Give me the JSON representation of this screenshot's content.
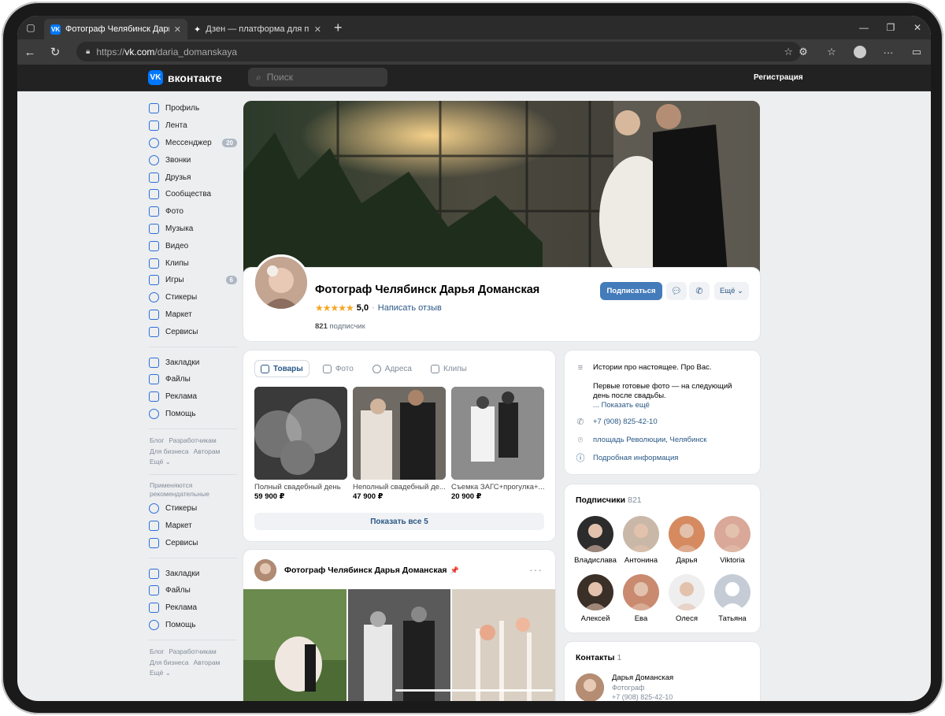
{
  "browser": {
    "tabs": [
      {
        "title": "Фотограф Челябинск Дарья Дом",
        "active": true
      },
      {
        "title": "Дзен — платформа для просмот",
        "active": false
      }
    ],
    "url_prefix": "https://",
    "url_host": "vk.com",
    "url_path": "/daria_domanskaya"
  },
  "vk": {
    "logo_text": "вконтакте",
    "search_placeholder": "Поиск",
    "register": "Регистрация"
  },
  "sidebar": {
    "items": [
      {
        "label": "Профиль",
        "icon": "user-icon"
      },
      {
        "label": "Лента",
        "icon": "news-icon"
      },
      {
        "label": "Мессенджер",
        "icon": "message-icon",
        "badge": "20"
      },
      {
        "label": "Звонки",
        "icon": "phone-icon"
      },
      {
        "label": "Друзья",
        "icon": "friends-icon"
      },
      {
        "label": "Сообщества",
        "icon": "groups-icon"
      },
      {
        "label": "Фото",
        "icon": "photo-icon"
      },
      {
        "label": "Музыка",
        "icon": "music-icon"
      },
      {
        "label": "Видео",
        "icon": "video-icon"
      },
      {
        "label": "Клипы",
        "icon": "clips-icon"
      },
      {
        "label": "Игры",
        "icon": "games-icon",
        "badge": "6"
      },
      {
        "label": "Стикеры",
        "icon": "sticker-icon"
      },
      {
        "label": "Маркет",
        "icon": "market-icon"
      },
      {
        "label": "Сервисы",
        "icon": "services-icon"
      }
    ],
    "items2": [
      {
        "label": "Закладки",
        "icon": "bookmark-icon"
      },
      {
        "label": "Файлы",
        "icon": "file-icon"
      },
      {
        "label": "Реклама",
        "icon": "ads-icon"
      },
      {
        "label": "Помощь",
        "icon": "help-icon"
      }
    ],
    "footer": {
      "blog": "Блог",
      "dev": "Разработчикам",
      "business": "Для бизнеса",
      "authors": "Авторам",
      "more": "Ещё ⌄"
    },
    "rec_text": "Применяются рекомендательные технологии",
    "items3": [
      {
        "label": "Стикеры",
        "icon": "sticker-icon"
      },
      {
        "label": "Маркет",
        "icon": "market-icon"
      },
      {
        "label": "Сервисы",
        "icon": "services-icon"
      }
    ],
    "items4": [
      {
        "label": "Закладки",
        "icon": "bookmark-icon"
      },
      {
        "label": "Файлы",
        "icon": "file-icon"
      },
      {
        "label": "Реклама",
        "icon": "ads-icon"
      },
      {
        "label": "Помощь",
        "icon": "help-icon"
      }
    ]
  },
  "profile": {
    "name": "Фотограф Челябинск Дарья Доманская",
    "stars": "★★★★★",
    "rating": "5,0",
    "review_link": "Написать отзыв",
    "subscribers_count": "821",
    "subscribers_label": "подписчик",
    "subscribe_btn": "Подписаться",
    "more_btn": "Ещё ⌄"
  },
  "goods": {
    "tabs": [
      "Товары",
      "Фото",
      "Адреса",
      "Клипы"
    ],
    "items": [
      {
        "name": "Полный свадебный день",
        "price": "59 900 ₽"
      },
      {
        "name": "Неполный свадебный де...",
        "price": "47 900 ₽"
      },
      {
        "name": "Съемка ЗАГС+прогулка+...",
        "price": "20 900 ₽"
      }
    ],
    "show_all": "Показать все 5"
  },
  "post": {
    "author": "Фотограф Челябинск Дарья Доманская",
    "pin": "📌",
    "dots": "···"
  },
  "about": {
    "line1": "Истории про настоящее. Про Вас.",
    "line2": "Первые готовые фото — на следующий день после свадьбы.",
    "show_more": "... Показать ещё",
    "phone": "+7 (908) 825-42-10",
    "address": "площадь Революции, Челябинск",
    "details": "Подробная информация"
  },
  "subscribers": {
    "title": "Подписчики",
    "count": "821",
    "people": [
      "Владислава",
      "Антонина",
      "Дарья",
      "Viktoria",
      "Алексей",
      "Ева",
      "Олеся",
      "Татьяна"
    ]
  },
  "contacts": {
    "title": "Контакты",
    "count": "1",
    "name": "Дарья Доманская",
    "role": "Фотограф",
    "phone": "+7 (908) 825-42-10"
  }
}
